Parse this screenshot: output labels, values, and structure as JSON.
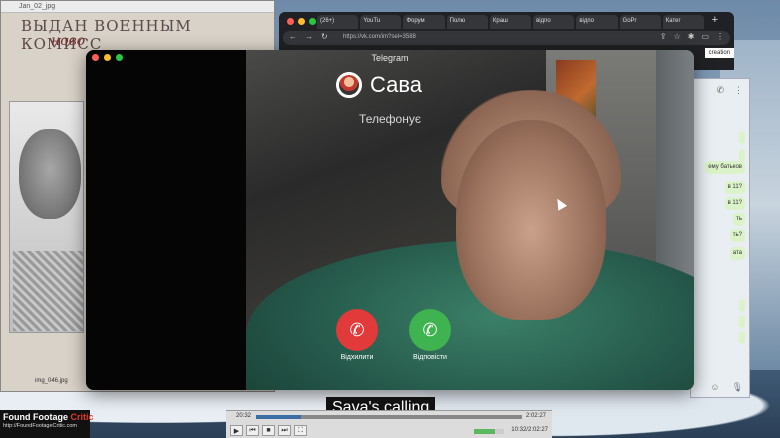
{
  "document_window": {
    "filename_top": "Jan_02_jpg",
    "stamp_line1": "ВЫДАН ВОЕННЫМ КОМИСС",
    "stamp_line2": "ново",
    "filename_bottom": "img_046.jpg"
  },
  "browser": {
    "tabs": [
      "(26+)",
      "YouTu",
      "Форум",
      "Полю",
      "Краш",
      "відпо",
      "відпо",
      "GoPr",
      "Катег"
    ],
    "url": "https://vk.com/im?sel=3588",
    "tagline": "creation"
  },
  "telegram_call": {
    "app_name": "Telegram",
    "caller_name": "Сава",
    "status": "Телефонує",
    "decline_label": "Відхилити",
    "accept_label": "Відповісти"
  },
  "chat_window": {
    "messages": [
      "",
      "",
      "",
      "ему батьков",
      "в 11?",
      "в 11?",
      "ть",
      "ть?",
      "ата",
      "",
      "",
      "",
      ""
    ]
  },
  "subtitle": "Sava's calling",
  "player": {
    "time_elapsed": "20:32",
    "time_total": "2:02:27",
    "time_bottom": "10:32/2:02:27",
    "progress": 0.17
  },
  "watermark": {
    "title_part1": "Found Footage ",
    "title_part2": "Critic",
    "url": "http://FoundFootageCritic.com"
  },
  "colors": {
    "decline": "#e2393b",
    "accept": "#3fb34f",
    "hoodie": "#3b8068"
  }
}
